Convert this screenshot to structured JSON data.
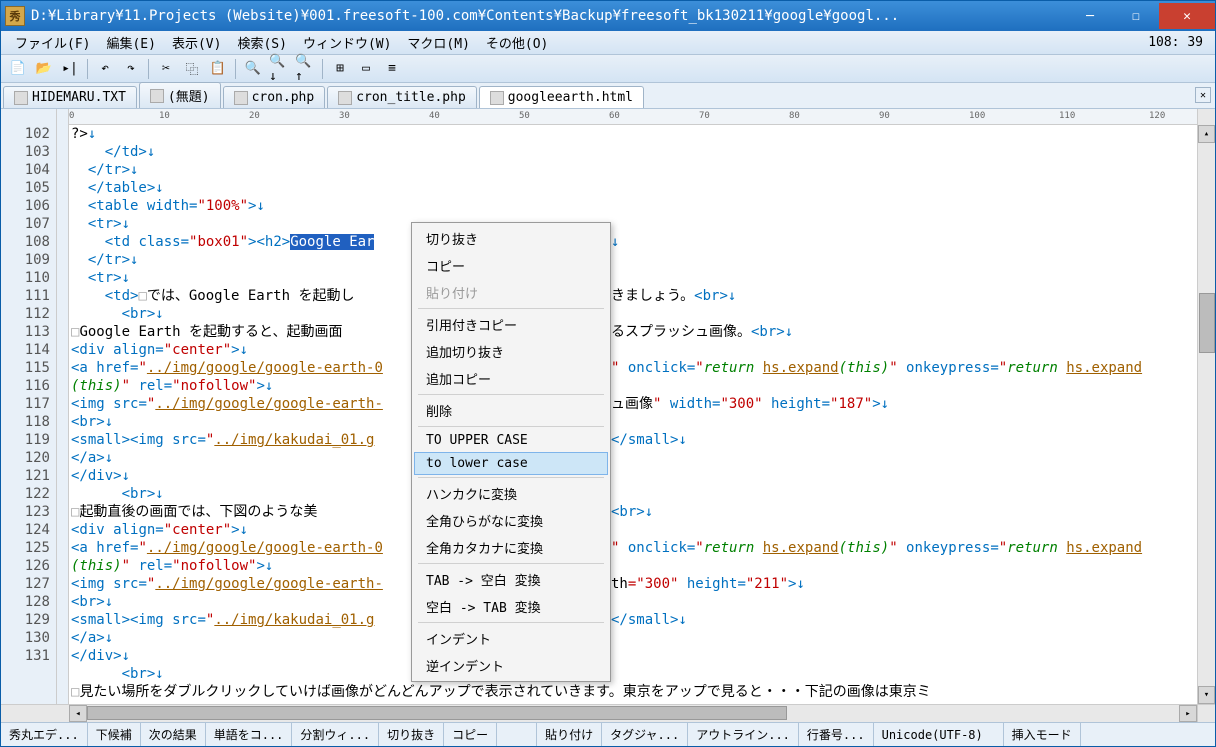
{
  "title": "D:¥Library¥11.Projects (Website)¥001.freesoft-100.com¥Contents¥Backup¥freesoft_bk130211¥google¥googl...",
  "titlebar_icon": "秀",
  "menubar": {
    "items": [
      "ファイル(F)",
      "編集(E)",
      "表示(V)",
      "検索(S)",
      "ウィンドウ(W)",
      "マクロ(M)",
      "その他(O)"
    ],
    "right": "108: 39"
  },
  "tabs": [
    {
      "label": "HIDEMARU.TXT",
      "active": false
    },
    {
      "label": "(無題)",
      "active": false
    },
    {
      "label": "cron.php",
      "active": false
    },
    {
      "label": "cron_title.php",
      "active": false
    },
    {
      "label": "googleearth.html",
      "active": true
    }
  ],
  "ruler_marks": [
    {
      "pos": 0,
      "label": "0"
    },
    {
      "pos": 90,
      "label": "10"
    },
    {
      "pos": 180,
      "label": "20"
    },
    {
      "pos": 270,
      "label": "30"
    },
    {
      "pos": 360,
      "label": "40"
    },
    {
      "pos": 450,
      "label": "50"
    },
    {
      "pos": 540,
      "label": "60"
    },
    {
      "pos": 630,
      "label": "70"
    },
    {
      "pos": 720,
      "label": "80"
    },
    {
      "pos": 810,
      "label": "90"
    },
    {
      "pos": 900,
      "label": "100"
    },
    {
      "pos": 990,
      "label": "110"
    },
    {
      "pos": 1080,
      "label": "120"
    }
  ],
  "line_start": 102,
  "line_end": 131,
  "code": {
    "l102": {
      "indent": 0,
      "html": "<span class='t-txt'>?&gt;</span><span class='t-newline'>↓</span>"
    },
    "l103": {
      "indent": 2,
      "html": "<span class='t-tag'>&lt;/td&gt;</span><span class='t-newline'>↓</span>"
    },
    "l104": {
      "indent": 1,
      "html": "<span class='t-tag'>&lt;/tr&gt;</span><span class='t-newline'>↓</span>"
    },
    "l105": {
      "indent": 1,
      "html": "<span class='t-tag'>&lt;/table&gt;</span><span class='t-newline'>↓</span>"
    },
    "l106": {
      "indent": 1,
      "html": "<span class='t-tag'>&lt;table </span><span class='t-attr'>width=</span><span class='t-val'>\"100%\"</span><span class='t-tag'>&gt;</span><span class='t-newline'>↓</span>"
    },
    "l107": {
      "indent": 1,
      "html": "<span class='t-tag'>&lt;tr&gt;</span><span class='t-newline'>↓</span>"
    },
    "l108": {
      "indent": 2,
      "html": "<span class='t-tag'>&lt;td </span><span class='t-attr'>class=</span><span class='t-val'>\"box01\"</span><span class='t-tag'>&gt;&lt;h2&gt;</span><span class='t-sel'>Google Ear</span>"
    },
    "l109": {
      "indent": 1,
      "html": "<span class='t-tag'>&lt;/tr&gt;</span><span class='t-newline'>↓</span>"
    },
    "l110": {
      "indent": 1,
      "html": "<span class='t-tag'>&lt;tr&gt;</span><span class='t-newline'>↓</span>"
    },
    "l111": {
      "indent": 2,
      "html": "<span class='t-tag'>&lt;td&gt;</span><span class='t-sq'>□</span><span class='t-txt'>では、Google Earth を起動し</span>"
    },
    "l111r": "<span class='t-txt'>きましょう。</span><span class='t-tag'>&lt;br&gt;</span><span class='t-newline'>↓</span>",
    "l112": {
      "indent": 3,
      "html": "<span class='t-tag'>&lt;br&gt;</span><span class='t-newline'>↓</span>"
    },
    "l113": {
      "indent": 0,
      "html": "<span class='t-sq'>□</span><span class='t-txt'>Google Earth を起動すると、起動画面</span>"
    },
    "l113r": "<span class='t-txt'>るスプラッシュ画像。</span><span class='t-tag'>&lt;br&gt;</span><span class='t-newline'>↓</span>",
    "l114": {
      "indent": 0,
      "html": "<span class='t-tag'>&lt;div </span><span class='t-attr'>align=</span><span class='t-val'>\"center\"</span><span class='t-tag'>&gt;</span><span class='t-newline'>↓</span>"
    },
    "l115": {
      "indent": 0,
      "html": "<span class='t-tag'>&lt;a </span><span class='t-attr'>href=</span><span class='t-val'>\"</span><span class='t-lnk'>../img/google/google-earth-0</span>"
    },
    "l115r": "<span class='t-val'>\"</span><span class='t-attr'> onclick=</span><span class='t-val'>\"</span><span class='t-green'>return </span><span class='t-lnk'>hs.expand</span><span class='t-green'>(this)</span><span class='t-val'>\"</span><span class='t-attr'> onkeypress=</span><span class='t-val'>\"</span><span class='t-green'>return </span><span class='t-lnk'>hs.expand</span>",
    "l115b": {
      "indent": 0,
      "html": "<span class='t-green'>(this)</span><span class='t-val'>\"</span><span class='t-attr'> rel=</span><span class='t-val'>\"nofollow\"</span><span class='t-tag'>&gt;</span><span class='t-newline'>↓</span>"
    },
    "l116": {
      "indent": 0,
      "html": "<span class='t-tag'>&lt;img </span><span class='t-attr'>src=</span><span class='t-val'>\"</span><span class='t-lnk'>../img/google/google-earth-</span>"
    },
    "l116r": "<span class='t-txt'>ュ画像</span><span class='t-val'>\"</span><span class='t-attr'> width=</span><span class='t-val'>\"300\"</span><span class='t-attr'> height=</span><span class='t-val'>\"187\"</span><span class='t-tag'>&gt;</span><span class='t-newline'>↓</span>",
    "l117": {
      "indent": 0,
      "html": "<span class='t-tag'>&lt;br&gt;</span><span class='t-newline'>↓</span>"
    },
    "l118": {
      "indent": 0,
      "html": "<span class='t-tag'>&lt;small&gt;&lt;img </span><span class='t-attr'>src=</span><span class='t-val'>\"</span><span class='t-lnk'>../img/kakudai_01.g</span>"
    },
    "l118r": "<span class='t-tag'>&lt;/small&gt;</span><span class='t-newline'>↓</span>",
    "l119": {
      "indent": 0,
      "html": "<span class='t-tag'>&lt;/a&gt;</span><span class='t-newline'>↓</span>"
    },
    "l120": {
      "indent": 0,
      "html": "<span class='t-tag'>&lt;/div&gt;</span><span class='t-newline'>↓</span>"
    },
    "l121": {
      "indent": 3,
      "html": "<span class='t-tag'>&lt;br&gt;</span><span class='t-newline'>↓</span>"
    },
    "l122": {
      "indent": 0,
      "html": "<span class='t-sq'>□</span><span class='t-txt'>起動直後の画面では、下図のような美</span>"
    },
    "l122r": "<span class='t-tag'>&lt;br&gt;</span><span class='t-newline'>↓</span>",
    "l123": {
      "indent": 0,
      "html": "<span class='t-tag'>&lt;div </span><span class='t-attr'>align=</span><span class='t-val'>\"center\"</span><span class='t-tag'>&gt;</span><span class='t-newline'>↓</span>"
    },
    "l124": {
      "indent": 0,
      "html": "<span class='t-tag'>&lt;a </span><span class='t-attr'>href=</span><span class='t-val'>\"</span><span class='t-lnk'>../img/google/google-earth-0</span>"
    },
    "l124r": "<span class='t-val'>\"</span><span class='t-attr'> onclick=</span><span class='t-val'>\"</span><span class='t-green'>return </span><span class='t-lnk'>hs.expand</span><span class='t-green'>(this)</span><span class='t-val'>\"</span><span class='t-attr'> onkeypress=</span><span class='t-val'>\"</span><span class='t-green'>return </span><span class='t-lnk'>hs.expand</span>",
    "l124b": {
      "indent": 0,
      "html": "<span class='t-green'>(this)</span><span class='t-val'>\"</span><span class='t-attr'> rel=</span><span class='t-val'>\"nofollow\"</span><span class='t-tag'>&gt;</span><span class='t-newline'>↓</span>"
    },
    "l125": {
      "indent": 0,
      "html": "<span class='t-tag'>&lt;img </span><span class='t-attr'>src=</span><span class='t-val'>\"</span><span class='t-lnk'>../img/google/google-earth-</span>"
    },
    "l125r": "<span class='t-txt'>th</span><span class='t-val'>=\"300\"</span><span class='t-attr'> height=</span><span class='t-val'>\"211\"</span><span class='t-tag'>&gt;</span><span class='t-newline'>↓</span>",
    "l126": {
      "indent": 0,
      "html": "<span class='t-tag'>&lt;br&gt;</span><span class='t-newline'>↓</span>"
    },
    "l127": {
      "indent": 0,
      "html": "<span class='t-tag'>&lt;small&gt;&lt;img </span><span class='t-attr'>src=</span><span class='t-val'>\"</span><span class='t-lnk'>../img/kakudai_01.g</span>"
    },
    "l127r": "<span class='t-tag'>&lt;/small&gt;</span><span class='t-newline'>↓</span>",
    "l128": {
      "indent": 0,
      "html": "<span class='t-tag'>&lt;/a&gt;</span><span class='t-newline'>↓</span>"
    },
    "l129": {
      "indent": 0,
      "html": "<span class='t-tag'>&lt;/div&gt;</span><span class='t-newline'>↓</span>"
    },
    "l130": {
      "indent": 3,
      "html": "<span class='t-tag'>&lt;br&gt;</span><span class='t-newline'>↓</span>"
    },
    "l131": {
      "indent": 0,
      "html": "<span class='t-sq'>□</span><span class='t-txt'>見たい場所をダブルクリックしていけば画像がどんどんアップで表示されていきます。東京をアップで見ると・・・下記の画像は東京ミ</span>"
    }
  },
  "right_fragments": {
    "108": "<span class='t-newline'>↓</span>"
  },
  "context_menu": [
    {
      "label": "切り抜き",
      "type": "item"
    },
    {
      "label": "コピー",
      "type": "item"
    },
    {
      "label": "貼り付け",
      "type": "disabled"
    },
    {
      "type": "sep"
    },
    {
      "label": "引用付きコピー",
      "type": "item"
    },
    {
      "label": "追加切り抜き",
      "type": "item"
    },
    {
      "label": "追加コピー",
      "type": "item"
    },
    {
      "type": "sep"
    },
    {
      "label": "削除",
      "type": "item"
    },
    {
      "type": "sep"
    },
    {
      "label": "TO UPPER CASE",
      "type": "item"
    },
    {
      "label": "to lower case",
      "type": "highlight"
    },
    {
      "type": "sep"
    },
    {
      "label": "ハンカクに変換",
      "type": "item"
    },
    {
      "label": "全角ひらがなに変換",
      "type": "item"
    },
    {
      "label": "全角カタカナに変換",
      "type": "item"
    },
    {
      "type": "sep"
    },
    {
      "label": "TAB -> 空白 変換",
      "type": "item"
    },
    {
      "label": "空白 -> TAB 変換",
      "type": "item"
    },
    {
      "type": "sep"
    },
    {
      "label": "インデント",
      "type": "item"
    },
    {
      "label": "逆インデント",
      "type": "item"
    }
  ],
  "statusbar": [
    "秀丸エデ...",
    "下候補",
    "次の結果",
    "単語をコ...",
    "分割ウィ...",
    "切り抜き",
    "コピー",
    "",
    "貼り付け",
    "タグジャ...",
    "アウトライン...",
    "行番号...",
    "Unicode(UTF-8)",
    "挿入モード"
  ]
}
